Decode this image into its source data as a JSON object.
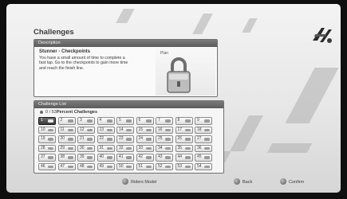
{
  "screen": {
    "title": "Challenges"
  },
  "description": {
    "header": "Description",
    "challenge_name": "Stunner - Checkpoints",
    "text": "You have a small amount of time to complete a fast lap. Go to the checkpoints to gain more time and reach the finish line.",
    "status_label": "Plan",
    "locked": true
  },
  "challenge_list": {
    "header": "Challenge List",
    "completed_count": "0 / 53",
    "subheader": "Percent Challenges",
    "selected_index": 0,
    "items": [
      "1",
      "2",
      "3",
      "4",
      "5",
      "6",
      "7",
      "8",
      "9",
      "10",
      "11",
      "12",
      "13",
      "14",
      "15",
      "16",
      "17",
      "18",
      "19",
      "20",
      "21",
      "22",
      "23",
      "24",
      "25",
      "26",
      "27",
      "28",
      "29",
      "30",
      "31",
      "32",
      "33",
      "34",
      "35",
      "36",
      "37",
      "38",
      "39",
      "40",
      "41",
      "42",
      "43",
      "44",
      "45",
      "46",
      "47",
      "48",
      "49",
      "50",
      "51",
      "52",
      "53",
      "54"
    ]
  },
  "footer": {
    "prompts": [
      {
        "label": "Riders Model",
        "icon": "y-button-icon"
      },
      {
        "label": "Back",
        "icon": "b-button-icon"
      },
      {
        "label": "Confirm",
        "icon": "a-button-icon"
      }
    ]
  },
  "colors": {
    "panel_header": "#666666",
    "selected_cell": "#444444",
    "background": "#e8e8e8"
  }
}
